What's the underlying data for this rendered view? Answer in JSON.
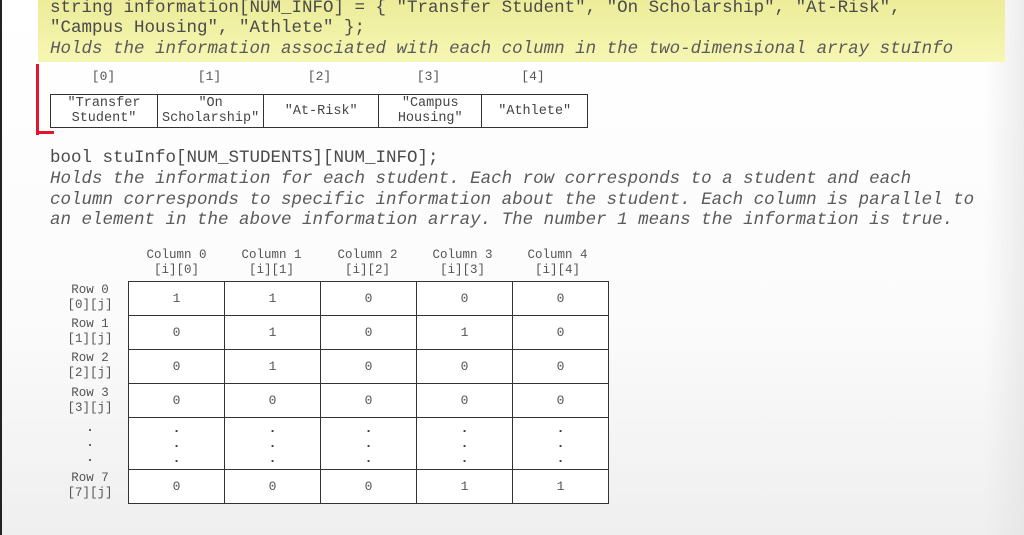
{
  "header_code": {
    "line1": "string information[NUM_INFO] = { \"Transfer Student\", \"On Scholarship\", \"At-Risk\",",
    "line2": "\"Campus Housing\", \"Athlete\" };",
    "comment": "Holds the information associated with each column in the two-dimensional array stuInfo"
  },
  "info_array": {
    "indices": [
      "[0]",
      "[1]",
      "[2]",
      "[3]",
      "[4]"
    ],
    "values": [
      "\"Transfer\nStudent\"",
      "\"On\nScholarship\"",
      "\"At-Risk\"",
      "\"Campus\nHousing\"",
      "\"Athlete\""
    ]
  },
  "stuinfo_code": {
    "declaration": "bool stuInfo[NUM_STUDENTS][NUM_INFO];",
    "comment_lines": [
      "Holds the information for each student. Each row corresponds to a student and each",
      "column corresponds to specific information about the student. Each column is parallel to",
      "an element in the above information array. The number 1 means the information is true."
    ]
  },
  "grid": {
    "columns": [
      {
        "label": "Column 0",
        "index": "[i][0]"
      },
      {
        "label": "Column 1",
        "index": "[i][1]"
      },
      {
        "label": "Column 2",
        "index": "[i][2]"
      },
      {
        "label": "Column 3",
        "index": "[i][3]"
      },
      {
        "label": "Column 4",
        "index": "[i][4]"
      }
    ],
    "rows": [
      {
        "label": "Row 0",
        "index": "[0][j]",
        "values": [
          "1",
          "1",
          "0",
          "0",
          "0"
        ]
      },
      {
        "label": "Row 1",
        "index": "[1][j]",
        "values": [
          "0",
          "1",
          "0",
          "1",
          "0"
        ]
      },
      {
        "label": "Row 2",
        "index": "[2][j]",
        "values": [
          "0",
          "1",
          "0",
          "0",
          "0"
        ]
      },
      {
        "label": "Row 3",
        "index": "[3][j]",
        "values": [
          "0",
          "0",
          "0",
          "0",
          "0"
        ]
      },
      {
        "label": "Row 7",
        "index": "[7][j]",
        "values": [
          "0",
          "0",
          "0",
          "1",
          "1"
        ]
      }
    ],
    "ellipsis": ".\n.\n."
  },
  "colors": {
    "highlight": "#f0f0a4",
    "bracket": "#e3142b"
  }
}
